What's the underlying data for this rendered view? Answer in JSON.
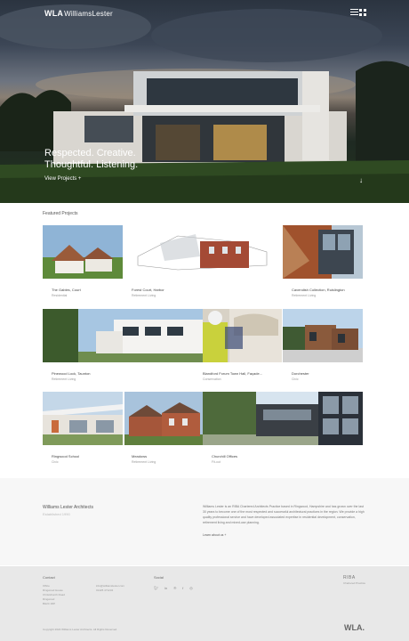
{
  "header": {
    "logo_abbr": "WLA",
    "logo_name": "WilliamsLester",
    "menu_icon": "hamburger-icon",
    "grid_icon": "grid-icon"
  },
  "hero": {
    "headline_line1": "Respected. Creative.",
    "headline_line2": "Thoughtful. Listening.",
    "cta_label": "View Projects +",
    "scroll_icon": "down-arrow-icon"
  },
  "featured": {
    "title": "Featured Projects",
    "projects": [
      {
        "name": "The Gables, Court",
        "category": "Residential"
      },
      {
        "name": "Forest Court, Harbor",
        "category": "Retirement Living"
      },
      {
        "name": "Cavendish Collection, Ruislington",
        "category": "Retirement Living"
      },
      {
        "name": "Pinewood Lock, Taunton",
        "category": "Retirement Living"
      },
      {
        "name": "Blandford Forum Town Hall, Façade...",
        "category": "Conservation"
      },
      {
        "name": "Dorchester",
        "category": "Civic"
      },
      {
        "name": "Ringwood School",
        "category": "Civic"
      },
      {
        "name": "Meadows",
        "category": "Retirement Living"
      },
      {
        "name": "Churchill Offices",
        "category": "Fit-out"
      }
    ]
  },
  "about": {
    "heading": "Williams Lester Architects",
    "subheading": "Established 1990",
    "text": "Williams Lester is an RIBA Chartered Architects Practice based in Ringwood, Hampshire and has grown over the last 30 years to become one of the most respected and successful architectural practices in the region. We provide a high quality professional service and have developed associated expertise in residential development, conservation, retirement living and mixed-use planning.",
    "link": "Learn about us +"
  },
  "footer": {
    "contact_title": "Contact",
    "contact_lines": [
      "Office",
      "Ringwood House",
      "Christchurch Road",
      "Ringwood",
      "BH24 1DP"
    ],
    "contact_email": "info@williamslester.com",
    "contact_phone": "01425 471234",
    "social_title": "Social",
    "social_icons": [
      "twitter-icon",
      "linkedin-icon",
      "pinterest-icon",
      "facebook-icon",
      "instagram-icon"
    ],
    "riba": "RIBA",
    "riba_sub": "Chartered Practice",
    "wla": "WLA.",
    "copyright": "Copyright 2022 Williams Lester Architects. All Rights Reserved."
  }
}
